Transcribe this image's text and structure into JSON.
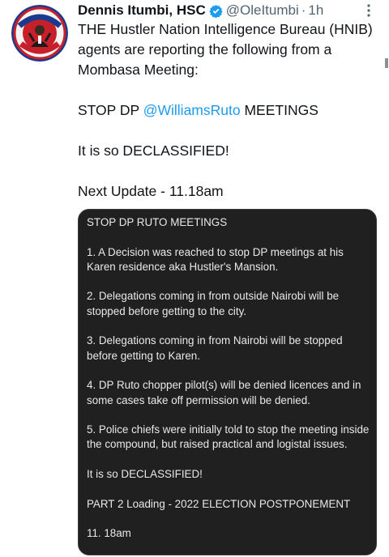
{
  "author": {
    "name": "Dennis Itumbi, HSC",
    "handle": "@OleItumbi",
    "separator": "·",
    "time": "1h",
    "avatar_text_top": "I'VE GOT",
    "avatar_text_bottom": "YOUR BACK"
  },
  "tweet": {
    "lines": [
      "THE Hustler Nation Intelligence Bureau (HNIB) agents are reporting the following from a Mombasa Meeting:"
    ],
    "stop_prefix": "STOP DP ",
    "mention": "@WilliamsRuto",
    "stop_suffix": " MEETINGS",
    "declassified": "It is so DECLASSIFIED!",
    "next_update": "Next Update - 11.18am"
  },
  "image": {
    "title": "STOP DP  RUTO MEETINGS",
    "points": [
      "1. A Decision was reached to stop DP meetings at his Karen residence aka Hustler's Mansion.",
      "2. Delegations coming in from outside Nairobi will be stopped before getting to the city.",
      "3. Delegations coming in from Nairobi will be stopped before getting to Karen.",
      "4. DP Ruto chopper pilot(s) will be denied licences and in some cases take off permission will be denied.",
      "5. Police chiefs were initially told to stop the meeting inside the compound, but raised practical and logistal issues."
    ],
    "declassified": "It is so DECLASSIFIED!",
    "part2": "PART 2 Loading - 2022 ELECTION POSTPONEMENT",
    "time": "11. 18am"
  },
  "colors": {
    "accent": "#1d9bf0",
    "image_bg": "#202020",
    "avatar_red": "#c8202a",
    "avatar_blue": "#1c3a8c"
  }
}
